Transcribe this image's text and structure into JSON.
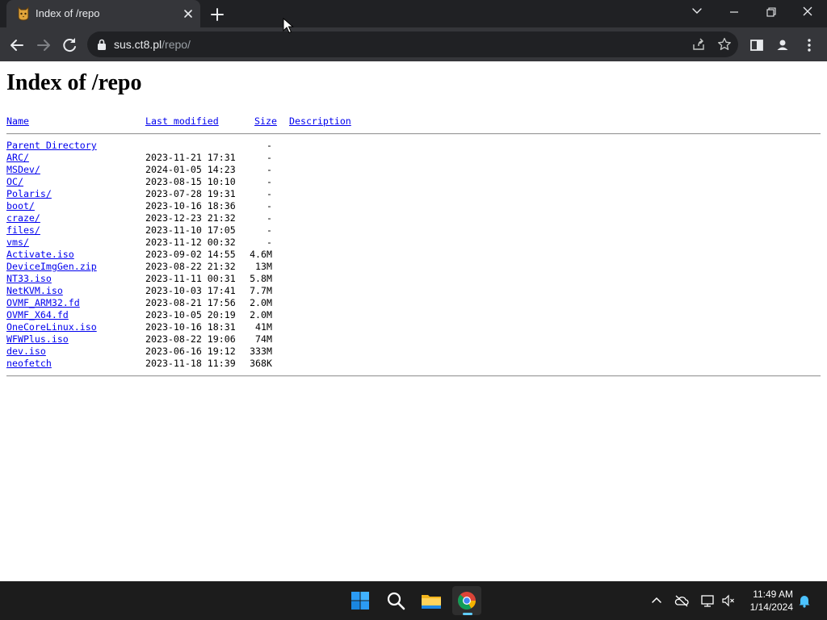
{
  "browser": {
    "tab": {
      "title": "Index of /repo"
    },
    "address": {
      "host": "sus.ct8.pl",
      "path": "/repo/"
    }
  },
  "page": {
    "heading": "Index of /repo",
    "columns": {
      "name": "Name",
      "modified": "Last modified",
      "size": "Size",
      "description": "Description"
    },
    "parent": {
      "name": "Parent Directory",
      "size": "-"
    },
    "entries": [
      {
        "name": "ARC/",
        "modified": "2023-11-21 17:31",
        "size": "-"
      },
      {
        "name": "MSDev/",
        "modified": "2024-01-05 14:23",
        "size": "-"
      },
      {
        "name": "OC/",
        "modified": "2023-08-15 10:10",
        "size": "-"
      },
      {
        "name": "Polaris/",
        "modified": "2023-07-28 19:31",
        "size": "-"
      },
      {
        "name": "boot/",
        "modified": "2023-10-16 18:36",
        "size": "-"
      },
      {
        "name": "craze/",
        "modified": "2023-12-23 21:32",
        "size": "-"
      },
      {
        "name": "files/",
        "modified": "2023-11-10 17:05",
        "size": "-"
      },
      {
        "name": "vms/",
        "modified": "2023-11-12 00:32",
        "size": "-"
      },
      {
        "name": "Activate.iso",
        "modified": "2023-09-02 14:55",
        "size": "4.6M"
      },
      {
        "name": "DeviceImgGen.zip",
        "modified": "2023-08-22 21:32",
        "size": "13M"
      },
      {
        "name": "NT33.iso",
        "modified": "2023-11-11 00:31",
        "size": "5.8M"
      },
      {
        "name": "NetKVM.iso",
        "modified": "2023-10-03 17:41",
        "size": "7.7M"
      },
      {
        "name": "OVMF_ARM32.fd",
        "modified": "2023-08-21 17:56",
        "size": "2.0M"
      },
      {
        "name": "OVMF_X64.fd",
        "modified": "2023-10-05 20:19",
        "size": "2.0M"
      },
      {
        "name": "OneCoreLinux.iso",
        "modified": "2023-10-16 18:31",
        "size": "41M"
      },
      {
        "name": "WFWPlus.iso",
        "modified": "2023-08-22 19:06",
        "size": "74M"
      },
      {
        "name": "dev.iso",
        "modified": "2023-06-16 19:12",
        "size": "333M"
      },
      {
        "name": "neofetch",
        "modified": "2023-11-18 11:39",
        "size": "368K"
      }
    ]
  },
  "taskbar": {
    "time": "11:49 AM",
    "date": "1/14/2024"
  },
  "colors": {
    "link": "#0000ee",
    "chrome_frame": "#202124",
    "chrome_toolbar": "#35363a",
    "taskbar": "#1c1c1c"
  }
}
